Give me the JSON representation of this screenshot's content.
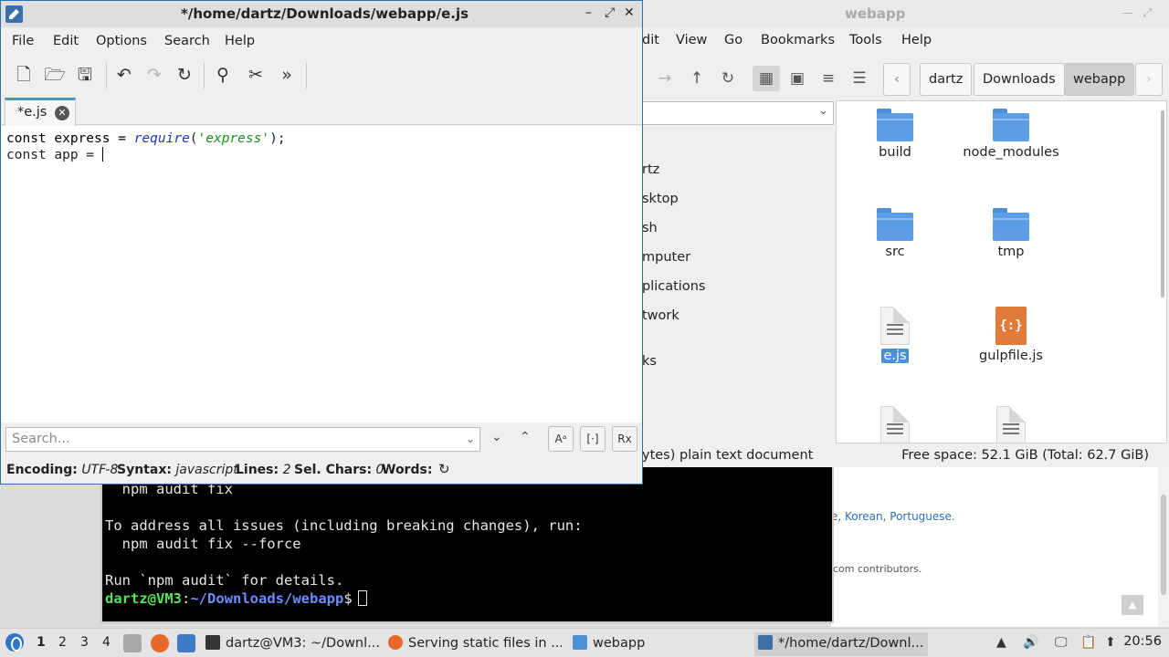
{
  "browser": {
    "langs_prefix": "e, ",
    "lang_korean": "Korean",
    "lang_sep": ", ",
    "lang_portuguese": "Portuguese",
    "langs_suffix": ".",
    "contrib": "com contributors."
  },
  "terminal": {
    "line1": "  npm audit fix",
    "line2": "To address all issues (including breaking changes), run:",
    "line3": "  npm audit fix --force",
    "line4": "Run `npm audit` for details.",
    "prompt_user": "dartz@VM3",
    "prompt_colon": ":",
    "prompt_path": "~/Downloads/webapp",
    "prompt_symbol": "$"
  },
  "file_manager": {
    "title": "webapp",
    "menu": [
      "dit",
      "View",
      "Go",
      "Bookmarks",
      "Tools",
      "Help"
    ],
    "breadcrumbs": [
      "dartz",
      "Downloads",
      "webapp"
    ],
    "sidebar": [
      "rtz",
      "sktop",
      "sh",
      "mputer",
      "plications",
      "twork",
      "ks"
    ],
    "files": [
      {
        "name": "build",
        "type": "folder"
      },
      {
        "name": "node_modules",
        "type": "folder"
      },
      {
        "name": "src",
        "type": "folder"
      },
      {
        "name": "tmp",
        "type": "folder"
      },
      {
        "name": "e.js",
        "type": "text",
        "selected": true
      },
      {
        "name": "gulpfile.js",
        "type": "js"
      }
    ],
    "status_left": "ytes) plain text document",
    "status_right": "Free space: 52.1 GiB (Total: 62.7 GiB)"
  },
  "editor": {
    "title": "*/home/dartz/Downloads/webapp/e.js",
    "menu": [
      "File",
      "Edit",
      "Options",
      "Search",
      "Help"
    ],
    "tab_label": "*e.js",
    "code": {
      "l1_a": "const express = ",
      "l1_fn": "require",
      "l1_b": "(",
      "l1_str": "'express'",
      "l1_c": ");",
      "l2": "const app = "
    },
    "search_placeholder": "Search...",
    "status": {
      "encoding_label": "Encoding:",
      "encoding_value": "UTF-8",
      "syntax_label": "Syntax:",
      "syntax_value": "javascript",
      "lines_label": "Lines:",
      "lines_value": "2",
      "selchars_label": "Sel. Chars:",
      "selchars_value": "0",
      "words_label": "Words:"
    }
  },
  "taskbar": {
    "workspaces": [
      "1",
      "2",
      "3",
      "4"
    ],
    "tasks": [
      {
        "label": "dartz@VM3: ~/Downl..."
      },
      {
        "label": "Serving static files in ..."
      },
      {
        "label": "webapp"
      },
      {
        "label": "*/home/dartz/Downl..."
      }
    ],
    "clock": "20:56"
  }
}
